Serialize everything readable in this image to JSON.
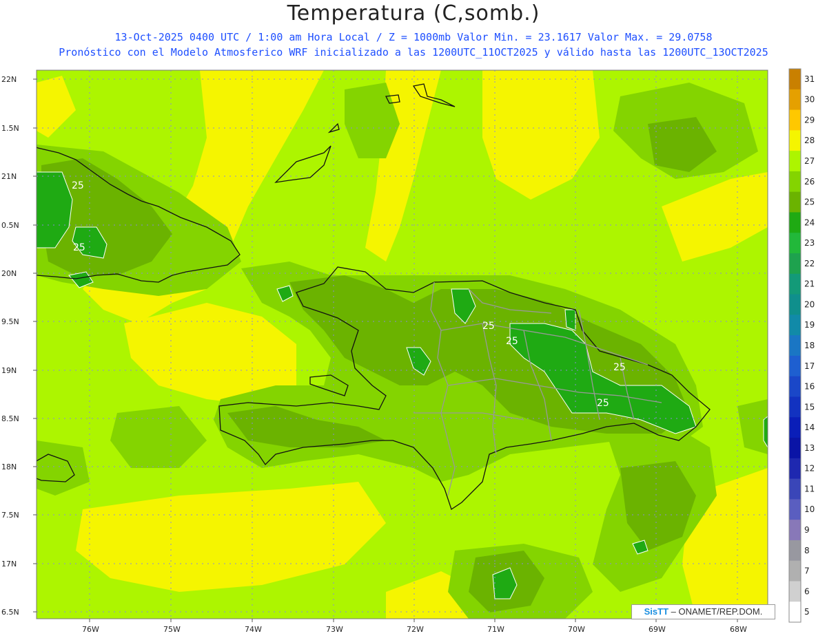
{
  "header": {
    "title": "Temperatura (C,somb.)",
    "line1": "13-Oct-2025  0400 UTC / 1:00 am Hora Local / Z = 1000mb   Valor Min. = 23.1617  Valor Max. = 29.0758",
    "line2": "Pronóstico con el Modelo Atmosferico WRF inicializado a las 1200UTC_11OCT2025 y válido hasta las  1200UTC_13OCT2025"
  },
  "map": {
    "lat_labels": [
      "22N",
      "1.5N",
      "21N",
      "0.5N",
      "20N",
      "9.5N",
      "19N",
      "8.5N",
      "18N",
      "7.5N",
      "17N",
      "6.5N"
    ],
    "lon_labels": [
      "76W",
      "75W",
      "74W",
      "73W",
      "72W",
      "71W",
      "70W",
      "69W",
      "68W"
    ],
    "contour_labels": [
      "25",
      "25",
      "25",
      "25",
      "25",
      "25"
    ],
    "colors": {
      "c28_29": "#f5f500",
      "c27_28": "#adf500",
      "c26_27": "#84d400",
      "c25_26": "#6bb300",
      "c24_25": "#1faa13",
      "grid": "#8a8ad8",
      "coast": "#111111",
      "border": "#999999"
    }
  },
  "colorbar": {
    "levels": [
      "31",
      "30",
      "29",
      "28",
      "27",
      "26",
      "25",
      "24",
      "23",
      "22",
      "21",
      "20",
      "19",
      "18",
      "17",
      "16",
      "15",
      "14",
      "13",
      "12",
      "11",
      "10",
      "9",
      "8",
      "7",
      "6",
      "5"
    ],
    "colors": [
      "#c98000",
      "#e5a000",
      "#ffc800",
      "#f5f500",
      "#adf500",
      "#84d400",
      "#6bb300",
      "#1faa13",
      "#22b83a",
      "#1ea24e",
      "#139a78",
      "#0f8f8c",
      "#118aa8",
      "#1a76c4",
      "#1e5fd0",
      "#1a47c8",
      "#1232c0",
      "#0a1eb8",
      "#0a14a6",
      "#1e28b0",
      "#3a46b8",
      "#5a5ec0",
      "#8878b8",
      "#9898a0",
      "#b0b0b0",
      "#d0d0d0",
      "#ffffff"
    ]
  },
  "credit": {
    "logo": "SisTT",
    "text": " – ONAMET/REP.DOM."
  }
}
